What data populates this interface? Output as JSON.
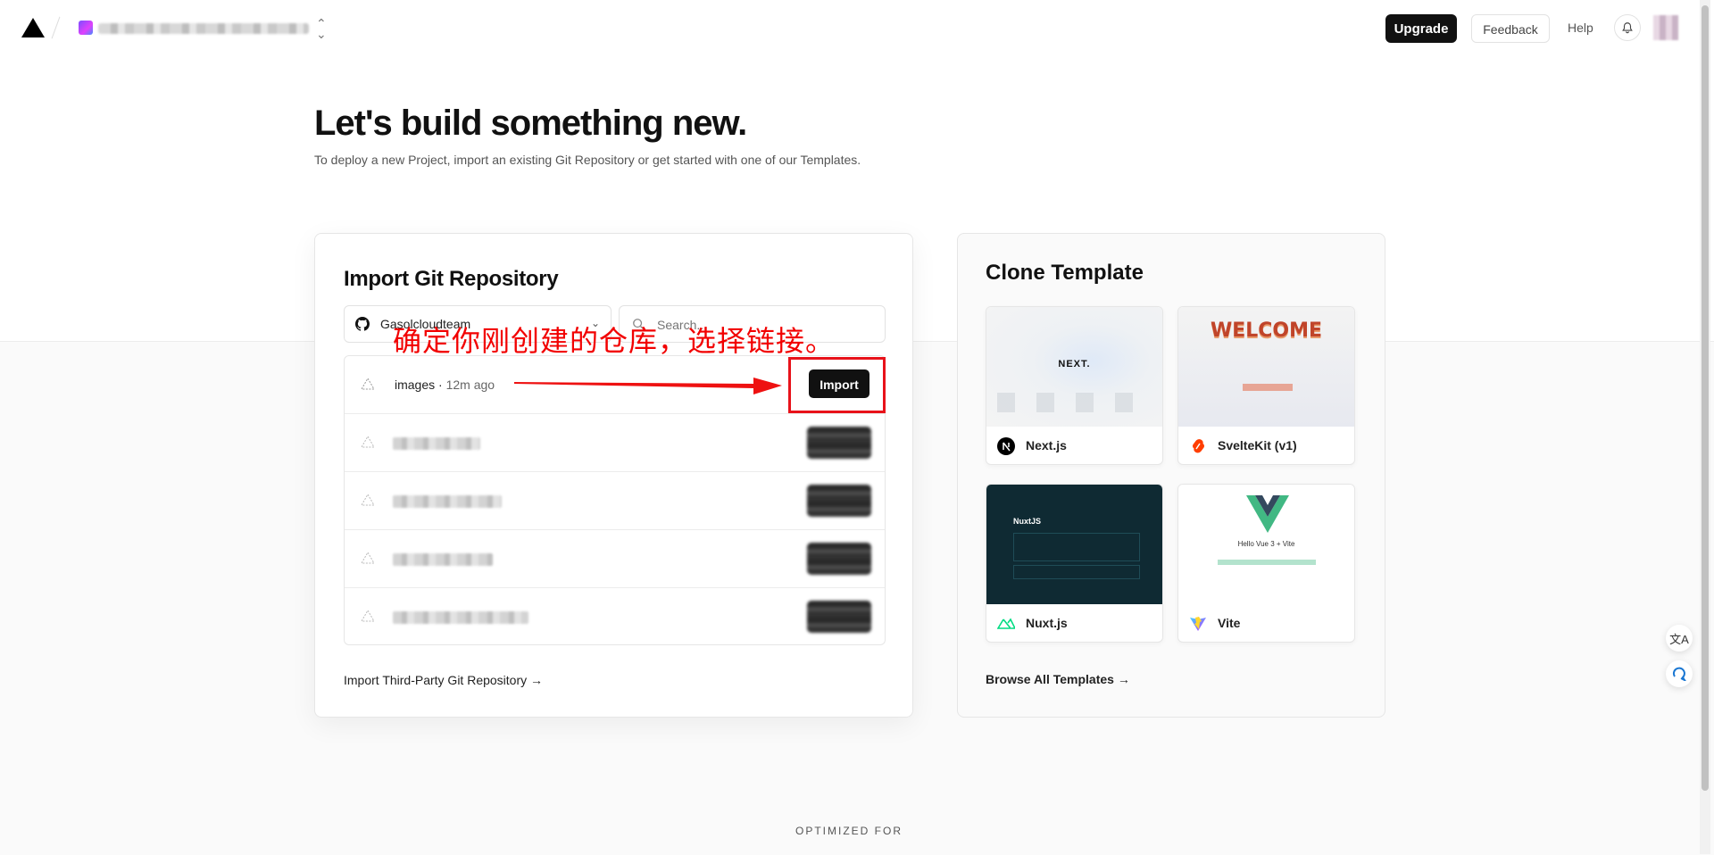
{
  "nav": {
    "upgrade": "Upgrade",
    "feedback": "Feedback",
    "help": "Help"
  },
  "hero": {
    "title": "Let's build something new.",
    "subtitle": "To deploy a new Project, import an existing Git Repository or get started with one of our Templates."
  },
  "import": {
    "title": "Import Git Repository",
    "owner": "Gasolcloudteam",
    "search_placeholder": "Search...",
    "repos": [
      {
        "name": "images",
        "time": "12m ago",
        "button": "Import"
      }
    ],
    "third_party_link": "Import Third-Party Git Repository →"
  },
  "annotation": {
    "text": "确定你刚创建的仓库，选择链接。",
    "color": "#f20000"
  },
  "clone": {
    "title": "Clone Template",
    "templates": [
      {
        "name": "Next.js",
        "icon": "nextjs-icon"
      },
      {
        "name": "SvelteKit (v1)",
        "icon": "svelte-icon"
      },
      {
        "name": "Nuxt.js",
        "icon": "nuxt-icon"
      },
      {
        "name": "Vite",
        "icon": "vite-icon"
      }
    ],
    "browse_link": "Browse All Templates →"
  },
  "thumbs": {
    "next_logo": "NEXT.",
    "svelte_welcome": "WELCOME",
    "nuxt_logo": "NuxtJS",
    "vite_text": "Hello Vue 3 + Vite"
  },
  "footer": {
    "optimized": "OPTIMIZED FOR"
  },
  "colors": {
    "accent": "#111111",
    "annotation_red": "#e8121a"
  }
}
